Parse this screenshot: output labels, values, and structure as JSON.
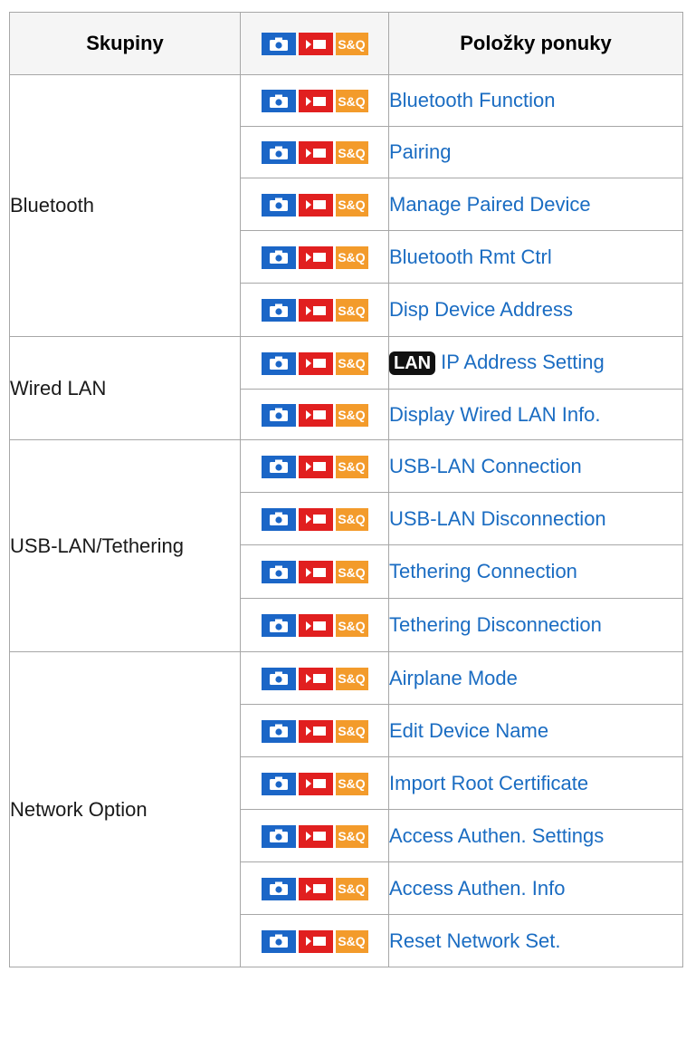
{
  "header": {
    "groups": "Skupiny",
    "items": "Položky ponuky"
  },
  "icon_set": {
    "photo": "camera-icon",
    "movie": "movie-icon",
    "sq_label": "S&Q"
  },
  "groups": [
    {
      "name": "Bluetooth",
      "items": [
        {
          "label": "Bluetooth Function"
        },
        {
          "label": "Pairing"
        },
        {
          "label": "Manage Paired Device"
        },
        {
          "label": "Bluetooth Rmt Ctrl"
        },
        {
          "label": "Disp Device Address"
        }
      ]
    },
    {
      "name": "Wired LAN",
      "items": [
        {
          "label": "IP Address Setting",
          "badge": "LAN"
        },
        {
          "label": "Display Wired LAN Info."
        }
      ]
    },
    {
      "name": "USB-LAN/Tethering",
      "items": [
        {
          "label": "USB-LAN Connection"
        },
        {
          "label": "USB-LAN Disconnection"
        },
        {
          "label": "Tethering Connection"
        },
        {
          "label": "Tethering Disconnection"
        }
      ]
    },
    {
      "name": "Network Option",
      "items": [
        {
          "label": "Airplane Mode"
        },
        {
          "label": "Edit Device Name"
        },
        {
          "label": "Import Root Certificate"
        },
        {
          "label": "Access Authen. Settings"
        },
        {
          "label": "Access Authen. Info"
        },
        {
          "label": "Reset Network Set."
        }
      ]
    }
  ]
}
